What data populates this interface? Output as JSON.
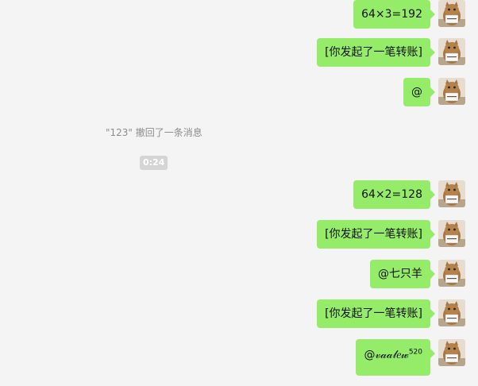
{
  "messages": [
    {
      "text": "64×3=192",
      "sender": "self"
    },
    {
      "text": "[你发起了一笔转账]",
      "sender": "self"
    },
    {
      "text": "@",
      "sender": "self"
    },
    {
      "text": "64×2=128",
      "sender": "self"
    },
    {
      "text": "[你发起了一笔转账]",
      "sender": "self"
    },
    {
      "text": "@七只羊",
      "sender": "self"
    },
    {
      "text": "[你发起了一笔转账]",
      "sender": "self"
    },
    {
      "text": "@𝓋𝒶𝒶𝓁𝑒𝓌",
      "suffix": "520",
      "sender": "self"
    }
  ],
  "system_note": "\"123\" 撤回了一条消息",
  "timestamp": "0:24",
  "colors": {
    "bubble_self": "#95ec69",
    "background": "#f4f4f4",
    "system_text": "#8c8c8c",
    "time_badge": "#d5d5d5"
  },
  "avatar_icon": "cat-avatar-icon"
}
